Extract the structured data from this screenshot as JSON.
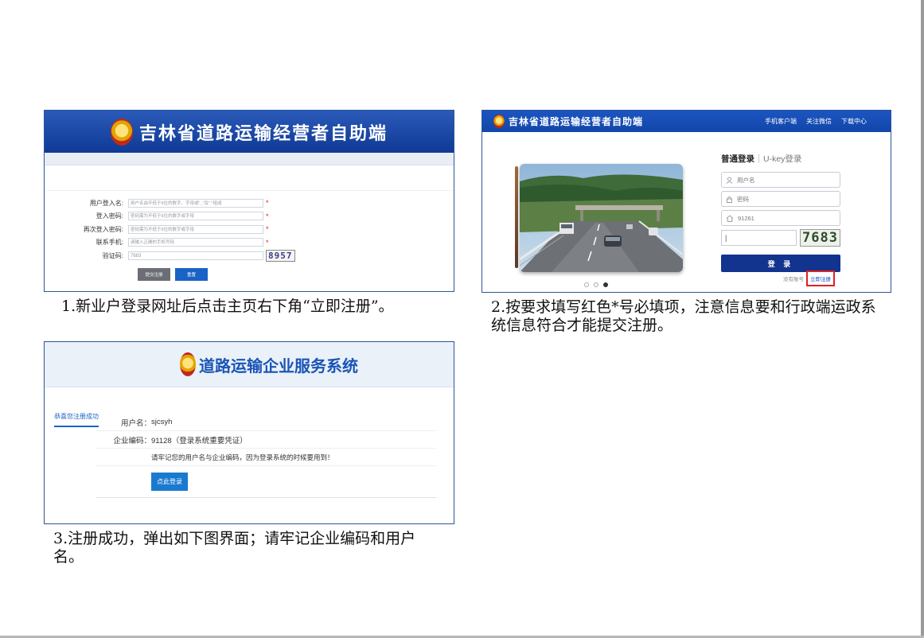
{
  "shot1": {
    "title": "吉林省道路运输经营者自助端",
    "fields": [
      {
        "label": "用户登入名:",
        "placeholder": "用户名由不低于6位的数字、字母或\"_\"及\".\"组成",
        "required": true
      },
      {
        "label": "登入密码:",
        "placeholder": "密码需为不低于6位的数字或字母",
        "required": true
      },
      {
        "label": "再次登入密码:",
        "placeholder": "密码需为不低于6位的数字或字母",
        "required": true
      },
      {
        "label": "联系手机:",
        "placeholder": "请输入正确的手机号码",
        "required": true
      }
    ],
    "captcha_label": "验证码:",
    "captcha_value": "7683",
    "captcha_code": "8957",
    "submit_label": "提交注册",
    "reset_label": "重置",
    "required_mark": "*"
  },
  "caption1": "1.新业户登录网址后点击主页右下角“立即注册”。",
  "shot2": {
    "title": "吉林省道路运输经营者自助端",
    "nav": [
      "手机客户端",
      "关注微信",
      "下载中心"
    ],
    "tab_active": "普通登录",
    "tab_other": "U-key登录",
    "username_placeholder": "用户名",
    "password_placeholder": "密码",
    "org_value": "91261",
    "captcha_input": "|",
    "captcha_code": "7683",
    "login_label": "登 录",
    "no_account": "没有账号",
    "register_link": "立即注册"
  },
  "caption2": "2.按要求填写红色*号必填项，注意信息要和行政端运政系统信息符合才能提交注册。",
  "shot3": {
    "title": "道路运输企业服务系统",
    "side_tab": "恭喜您注册成功",
    "username_label": "用户名：",
    "username_value": "sjcsyh",
    "code_label": "企业编码：",
    "code_value": "91128（登录系统重要凭证）",
    "note": "请牢记您的用户名与企业编码，因为登录系统的时候要用到！",
    "login_button": "点此登录"
  },
  "caption3": "3.注册成功，弹出如下图界面；请牢记企业编码和用户名。",
  "colors": {
    "brand_blue": "#1246aa",
    "required_red": "#e02020",
    "button_blue": "#1a7ad0"
  }
}
